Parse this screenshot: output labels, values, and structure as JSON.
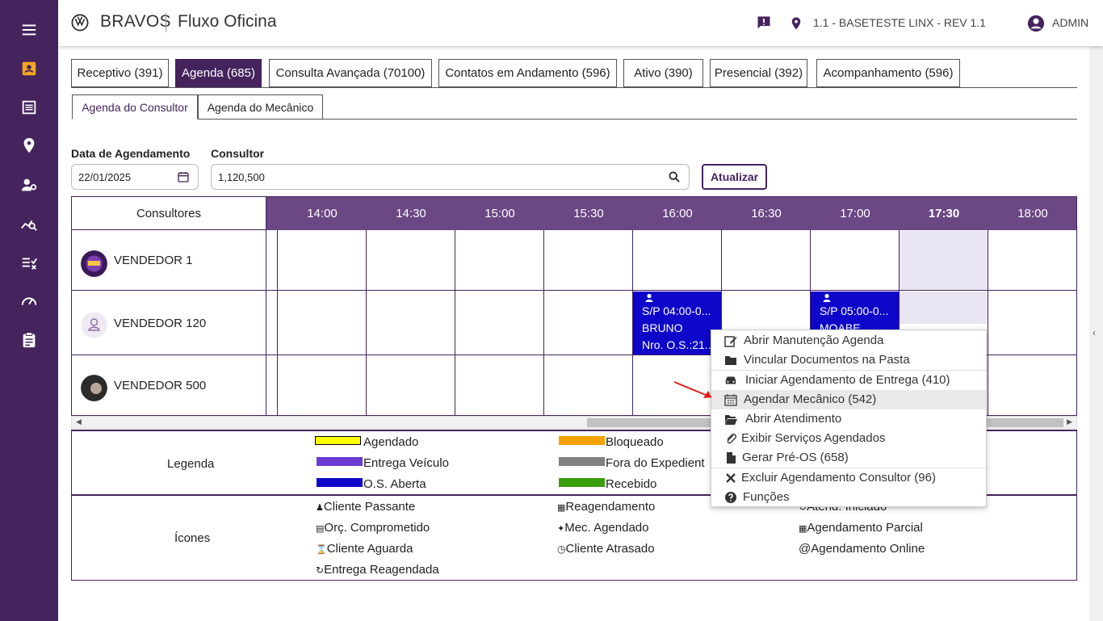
{
  "topbar": {
    "brand": "BRAVOS",
    "app": "Fluxo Oficina",
    "location": "1.1 - BASETESTE LINX - REV 1.1",
    "user": "ADMIN"
  },
  "sidebar": {
    "items": [
      "menu-icon",
      "agenda-icon",
      "list-icon",
      "pin-icon",
      "users-gear-icon",
      "chart-search-icon",
      "checklist-icon",
      "speedometer-icon",
      "clipboard-icon"
    ]
  },
  "tabs": [
    {
      "label": "Receptivo (391)",
      "active": false
    },
    {
      "label": "Agenda (685)",
      "active": true
    },
    {
      "label": "Consulta Avançada (70100)",
      "active": false
    },
    {
      "label": "Contatos em Andamento (596)",
      "active": false
    },
    {
      "label": "Ativo (390)",
      "active": false
    },
    {
      "label": "Presencial (392)",
      "active": false
    },
    {
      "label": "Acompanhamento (596)",
      "active": false
    }
  ],
  "subtabs": [
    {
      "label": "Agenda do Consultor",
      "active": true
    },
    {
      "label": "Agenda do Mecânico",
      "active": false
    }
  ],
  "filters": {
    "date_label": "Data de Agendamento",
    "date_value": "22/01/2025",
    "consultor_label": "Consultor",
    "consultor_value": "1,120,500",
    "button": "Atualizar"
  },
  "grid": {
    "header": "Consultores",
    "times": [
      "14:00",
      "14:30",
      "15:00",
      "15:30",
      "16:00",
      "16:30",
      "17:00",
      "17:30",
      "18:00"
    ],
    "current_time": "17:30",
    "rows": [
      {
        "name": "VENDEDOR 1"
      },
      {
        "name": "VENDEDOR 120"
      },
      {
        "name": "VENDEDOR 500"
      }
    ],
    "appointments": [
      {
        "line1": "S/P 04:00-0...",
        "line2": "BRUNO",
        "line3": "Nro. O.S.:21..."
      },
      {
        "line1": "S/P 05:00-0...",
        "line2": "MOABE"
      }
    ]
  },
  "legend": {
    "title": "Legenda",
    "items": [
      {
        "label": "Agendado",
        "color": "#ffff00"
      },
      {
        "label": "Bloqueado",
        "color": "#f5a100"
      },
      {
        "label": "Entrega Veículo",
        "color": "#6a3bd1"
      },
      {
        "label": "Fora do Expedient",
        "color": "#808080"
      },
      {
        "label": "O.S. Aberta",
        "color": "#0e06c9"
      },
      {
        "label": "Recebido",
        "color": "#3a9d0c"
      }
    ]
  },
  "icons_legend": {
    "title": "Ícones",
    "items": [
      {
        "label": "Cliente Passante",
        "glyph": "👤"
      },
      {
        "label": "Reagendamento",
        "glyph": "📅"
      },
      {
        "label": "Atend. Iniciado",
        "glyph": "↻"
      },
      {
        "label": "Orç. Comprometido",
        "glyph": "📄"
      },
      {
        "label": "Mec. Agendado",
        "glyph": "🔧"
      },
      {
        "label": "Agendamento Parcial",
        "glyph": "📅"
      },
      {
        "label": "Cliente Aguarda",
        "glyph": "⌛"
      },
      {
        "label": "Cliente Atrasado",
        "glyph": "🕓"
      },
      {
        "label": "Agendamento Online",
        "glyph": "@"
      },
      {
        "label": "Entrega Reagendada",
        "glyph": "↻"
      }
    ]
  },
  "context_menu": {
    "items": [
      {
        "label": "Abrir Manutenção Agenda",
        "icon": "edit-icon"
      },
      {
        "label": "Vincular Documentos na Pasta",
        "icon": "folder-icon"
      },
      {
        "label": "Iniciar Agendamento de Entrega (410)",
        "icon": "car-icon"
      },
      {
        "label": "Agendar Mecânico (542)",
        "icon": "calendar-icon",
        "highlighted": true
      },
      {
        "label": "Abrir Atendimento",
        "icon": "folder-open-icon"
      },
      {
        "label": "Exibir Serviços Agendados",
        "icon": "paperclip-icon"
      },
      {
        "label": "Gerar Pré-OS (658)",
        "icon": "file-icon"
      },
      {
        "label": "Excluir Agendamento Consultor (96)",
        "icon": "close-icon"
      },
      {
        "label": "Funções",
        "icon": "question-icon"
      }
    ]
  }
}
